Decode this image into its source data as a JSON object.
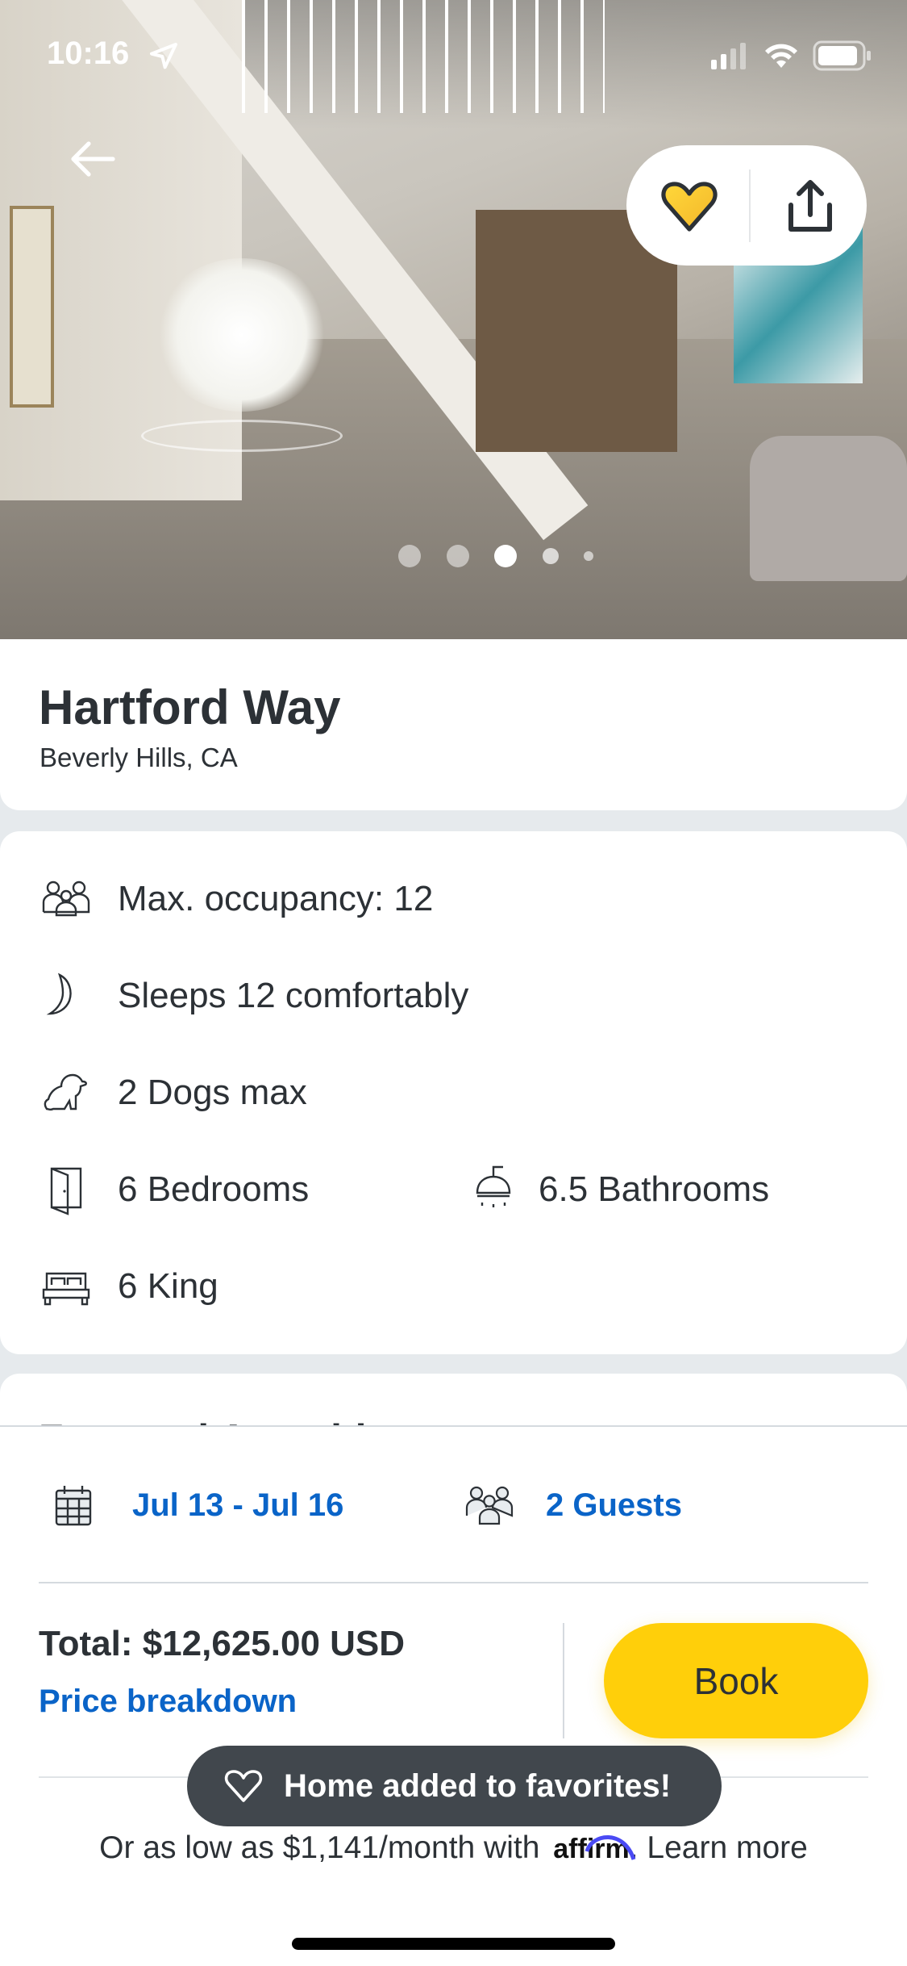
{
  "status_bar": {
    "time": "10:16"
  },
  "gallery": {
    "slide_count": 5,
    "active_slide": 3
  },
  "listing": {
    "title": "Hartford Way",
    "location": "Beverly Hills, CA",
    "favorited": true
  },
  "details": [
    {
      "icon": "people-icon",
      "label": "Max. occupancy: 12"
    },
    {
      "icon": "moon-icon",
      "label": "Sleeps 12 comfortably"
    },
    {
      "icon": "dog-icon",
      "label": "2 Dogs max"
    },
    {
      "icon": "door-icon",
      "label": "6 Bedrooms"
    },
    {
      "icon": "shower-icon",
      "label": "6.5 Bathrooms"
    },
    {
      "icon": "bed-icon",
      "label": "6 King"
    }
  ],
  "next_section": {
    "title": "Featured Amenities"
  },
  "booking": {
    "dates": "Jul 13 - Jul 16",
    "guests": "2 Guests",
    "total": "Total: $12,625.00 USD",
    "price_breakdown": "Price breakdown",
    "book_label": "Book",
    "affirm_prefix": "Or as low as $1,141/month with",
    "affirm_logo": "affirm",
    "affirm_suffix": ". Learn more"
  },
  "toast": {
    "message": "Home added to favorites!"
  },
  "colors": {
    "accent_yellow": "#ffcf0a",
    "link_blue": "#0a64c8",
    "toast_bg": "#41474d",
    "text": "#2c3136"
  }
}
